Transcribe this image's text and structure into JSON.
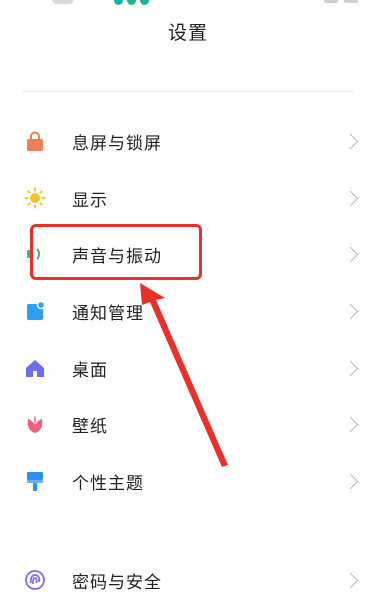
{
  "header": {
    "title": "设置"
  },
  "settings": {
    "items": [
      {
        "label": "息屏与锁屏",
        "icon": "lock-icon",
        "color": "#f07c5a"
      },
      {
        "label": "显示",
        "icon": "sun-icon",
        "color": "#f6c22b"
      },
      {
        "label": "声音与振动",
        "icon": "speaker-icon",
        "color": "#3fbe6a"
      },
      {
        "label": "通知管理",
        "icon": "notification-icon",
        "color": "#2d9ef0"
      },
      {
        "label": "桌面",
        "icon": "home-icon",
        "color": "#6b6ef0"
      },
      {
        "label": "壁纸",
        "icon": "flower-icon",
        "color": "#f0607a"
      },
      {
        "label": "个性主题",
        "icon": "brush-icon",
        "color": "#2d8ff0"
      },
      {
        "label": "密码与安全",
        "icon": "fingerprint-icon",
        "color": "#7b6cf0"
      }
    ]
  },
  "annotation": {
    "highlight_color": "#e8312b",
    "highlight_item": "声音与振动"
  }
}
